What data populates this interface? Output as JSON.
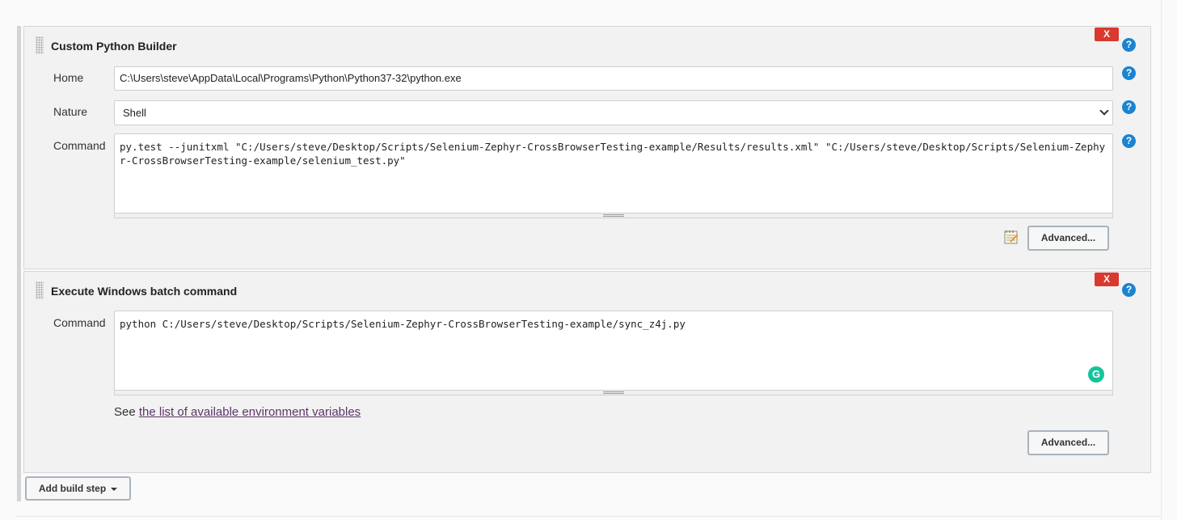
{
  "builders": [
    {
      "title": "Custom Python Builder",
      "delete_label": "X",
      "help_label": "?",
      "home_label": "Home",
      "home_value": "C:\\Users\\steve\\AppData\\Local\\Programs\\Python\\Python37-32\\python.exe",
      "nature_label": "Nature",
      "nature_selected": "Shell",
      "command_label": "Command",
      "command_value": "py.test --junitxml \"C:/Users/steve/Desktop/Scripts/Selenium-Zephyr-CrossBrowserTesting-example/Results/results.xml\" \"C:/Users/steve/Desktop/Scripts/Selenium-Zephyr-CrossBrowserTesting-example/selenium_test.py\"",
      "advanced_label": "Advanced..."
    },
    {
      "title": "Execute Windows batch command",
      "delete_label": "X",
      "help_label": "?",
      "command_label": "Command",
      "command_value": "python C:/Users/steve/Desktop/Scripts/Selenium-Zephyr-CrossBrowserTesting-example/sync_z4j.py",
      "env_prefix": "See ",
      "env_link": "the list of available environment variables",
      "advanced_label": "Advanced..."
    }
  ],
  "add_build_step_label": "Add build step",
  "icons": {
    "drag": "drag-handle-icon",
    "delete": "delete-icon",
    "help": "help-icon",
    "notepad": "notepad-icon",
    "grammarly": "grammarly-icon",
    "dropdown": "chevron-down-icon"
  },
  "colors": {
    "delete": "#d9392f",
    "help": "#1b84d1",
    "link": "#5c3566",
    "grammarly": "#15c39a"
  }
}
